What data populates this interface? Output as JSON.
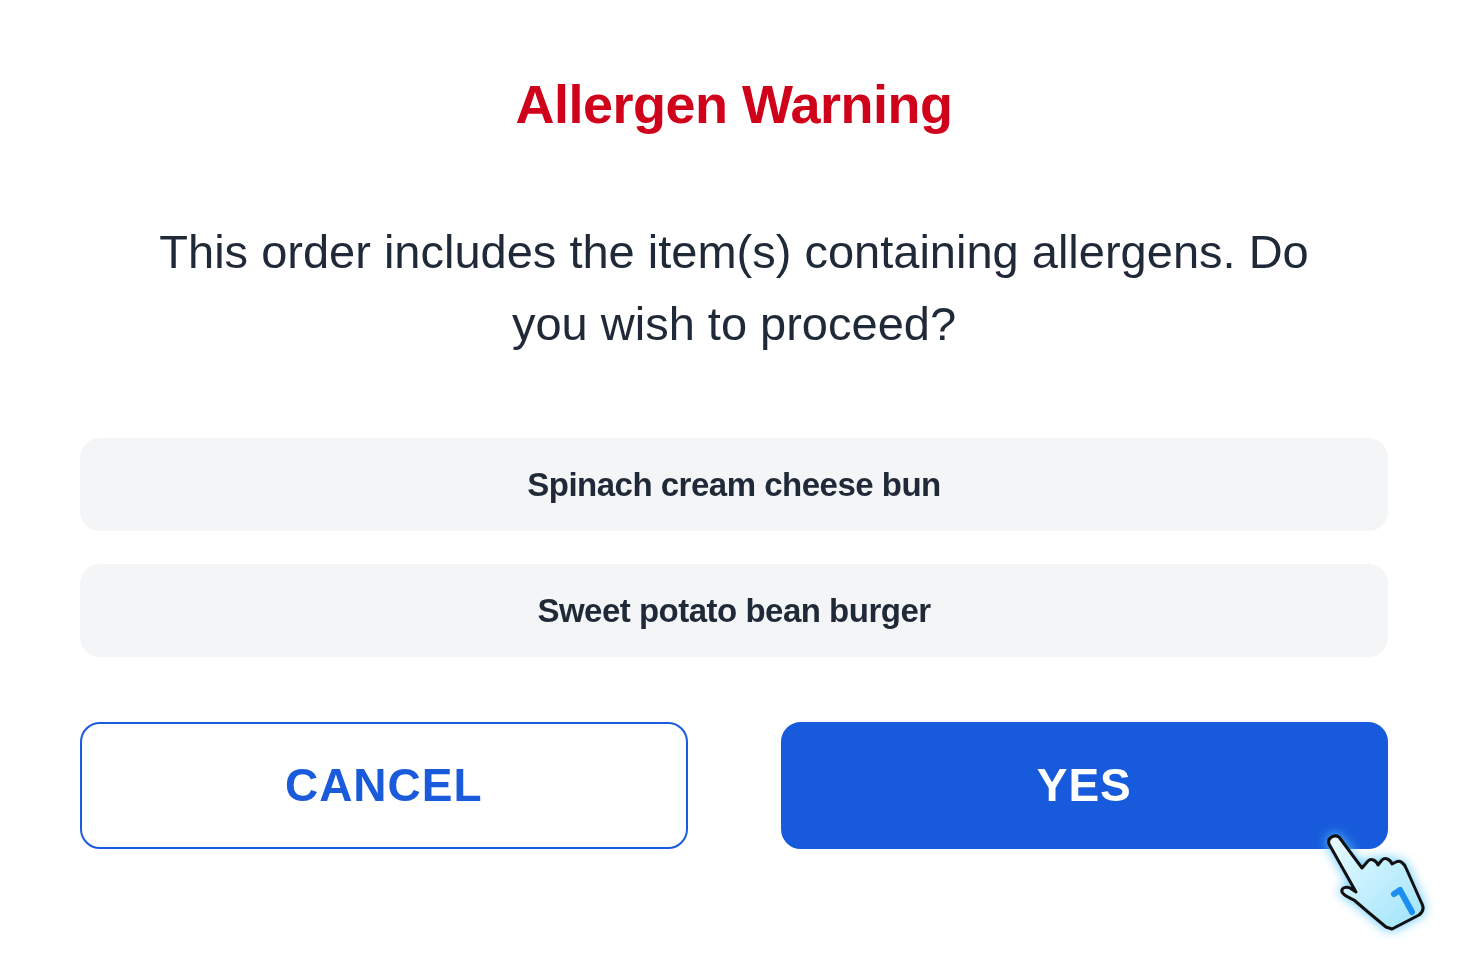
{
  "dialog": {
    "title": "Allergen Warning",
    "message": "This order includes the item(s) containing allergens. Do you wish to proceed?"
  },
  "items": [
    "Spinach cream cheese bun",
    "Sweet potato bean burger"
  ],
  "buttons": [
    {
      "label": "CANCEL",
      "kind": "outline"
    },
    {
      "label": "YES",
      "kind": "primary"
    }
  ]
}
